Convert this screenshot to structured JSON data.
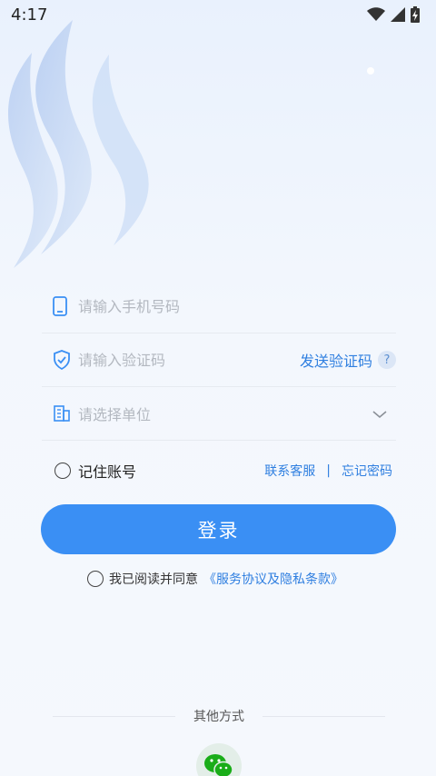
{
  "status_bar": {
    "time": "4:17",
    "icons": [
      "wifi-icon",
      "signal-icon",
      "battery-charging-icon"
    ]
  },
  "colors": {
    "accent": "#3a8ff4",
    "link": "#2f7fe0",
    "wechat_green": "#1aad19"
  },
  "form": {
    "phone": {
      "icon": "phone-icon",
      "placeholder": "请输入手机号码"
    },
    "code": {
      "icon": "shield-check-icon",
      "placeholder": "请输入验证码",
      "send_label": "发送验证码",
      "help": "?"
    },
    "unit": {
      "icon": "building-icon",
      "placeholder": "请选择单位"
    }
  },
  "options": {
    "remember_label": "记住账号",
    "contact_label": "联系客服",
    "separator": "|",
    "forgot_label": "忘记密码"
  },
  "login": {
    "label": "登录"
  },
  "agreement": {
    "prefix": "我已阅读并同意",
    "link": "《服务协议及隐私条款》"
  },
  "other_methods": {
    "label": "其他方式",
    "wechat_icon": "wechat-icon"
  }
}
